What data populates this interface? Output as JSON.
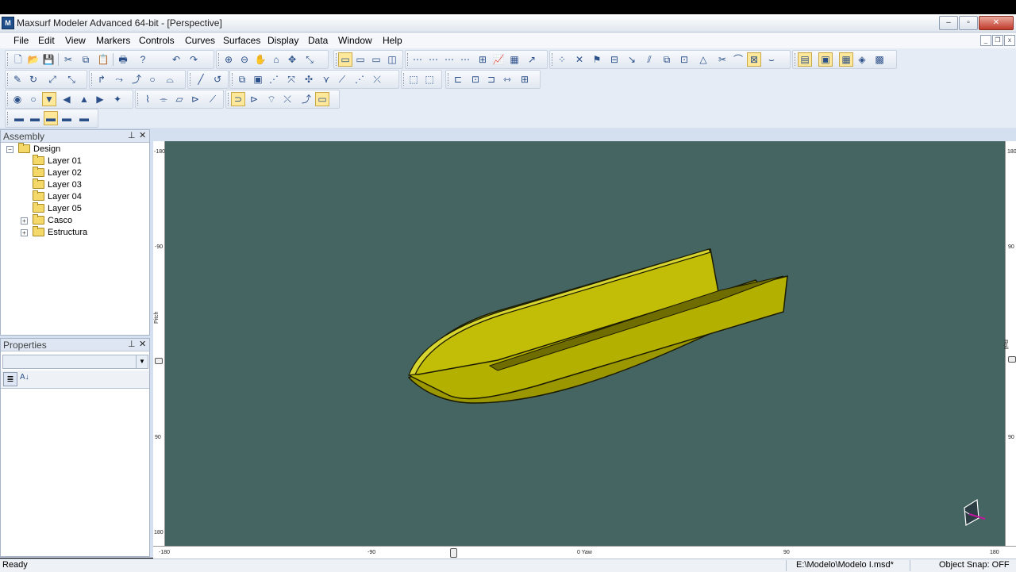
{
  "window": {
    "title": "Maxsurf Modeler Advanced 64-bit - [Perspective]",
    "app_icon_label": "M",
    "controls": {
      "minimize": "–",
      "maximize": "▫",
      "close": "✕"
    }
  },
  "menu": {
    "items": [
      "File",
      "Edit",
      "View",
      "Markers",
      "Controls",
      "Curves",
      "Surfaces",
      "Display",
      "Data",
      "Window",
      "Help"
    ],
    "mdi": {
      "minimize": "_",
      "restore": "❐",
      "close": "x"
    }
  },
  "assembly": {
    "title": "Assembly",
    "pin": "⊥",
    "close": "✕",
    "root": "Design",
    "layers": [
      "Layer 01",
      "Layer 02",
      "Layer 03",
      "Layer 04",
      "Layer 05"
    ],
    "groups": [
      "Casco",
      "Estructura"
    ]
  },
  "properties": {
    "title": "Properties",
    "pin": "⊥",
    "close": "✕",
    "combo_value": "",
    "sort_category_icon": "≣",
    "sort_alpha_icon": "A↓"
  },
  "viewport": {
    "view": "Perspective",
    "hull_color": "#b4b000",
    "background_color": "#456563",
    "left_ruler": {
      "label": "Pitch",
      "ticks": [
        "-180",
        "-90",
        "0",
        "90",
        "180"
      ]
    },
    "right_ruler": {
      "label": "Roll",
      "ticks": [
        "180",
        "90",
        "0",
        "90"
      ]
    },
    "bottom_ruler": {
      "label": "0 Yaw",
      "ticks": [
        "-180",
        "-90",
        "90",
        "180"
      ]
    }
  },
  "status": {
    "left": "Ready",
    "file": "E:\\Modelo\\Modelo I.msd*",
    "snap": "Object Snap: OFF"
  }
}
